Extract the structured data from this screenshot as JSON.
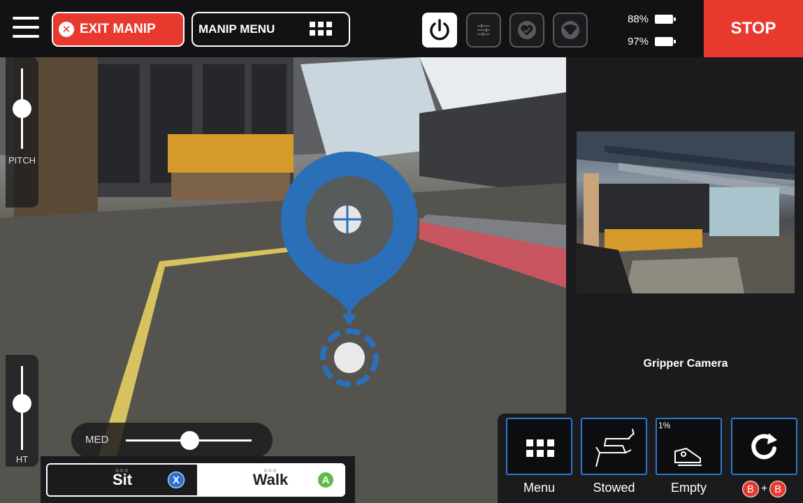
{
  "topbar": {
    "exit_label": "EXIT MANIP",
    "manip_menu_label": "MANIP MENU",
    "battery": [
      {
        "value": "88%"
      },
      {
        "value": "97%"
      }
    ],
    "stop_label": "STOP"
  },
  "sliders": {
    "pitch_label": "PITCH",
    "height_label": "HT",
    "speed_label": "MED"
  },
  "mode": {
    "sit_label": "Sit",
    "sit_key": "X",
    "walk_label": "Walk",
    "walk_key": "A",
    "dots": "○○○"
  },
  "gripper": {
    "label": "Gripper Camera"
  },
  "actions": {
    "menu_label": "Menu",
    "stowed_label": "Stowed",
    "empty_label": "Empty",
    "empty_percent": "1%",
    "reset_key_a": "B",
    "reset_plus": "+",
    "reset_key_b": "B"
  },
  "colors": {
    "alert_red": "#e8392f",
    "accent_blue": "#2d78cf",
    "target_blue": "#2a6fb8"
  }
}
